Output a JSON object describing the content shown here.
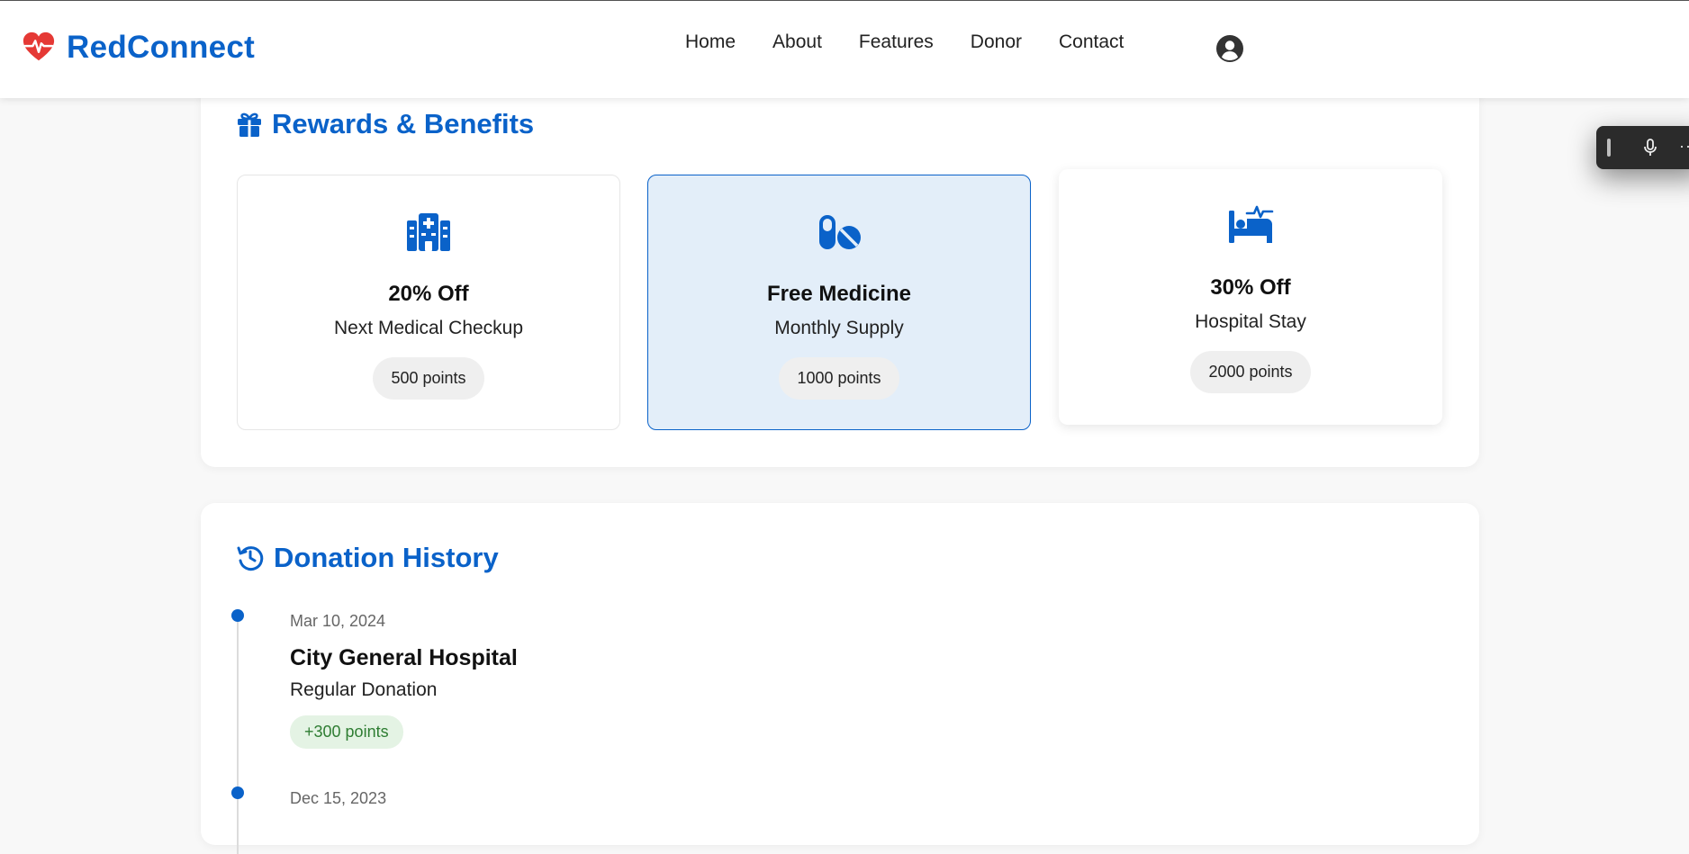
{
  "header": {
    "brand": "RedConnect",
    "nav": [
      "Home",
      "About",
      "Features",
      "Donor",
      "Contact"
    ]
  },
  "rewards": {
    "title": "Rewards & Benefits",
    "items": [
      {
        "title": "20% Off",
        "subtitle": "Next Medical Checkup",
        "points": "500 points",
        "icon": "hospital-icon"
      },
      {
        "title": "Free Medicine",
        "subtitle": "Monthly Supply",
        "points": "1000 points",
        "icon": "pills-icon",
        "selected": true
      },
      {
        "title": "30% Off",
        "subtitle": "Hospital Stay",
        "points": "2000 points",
        "icon": "hospital-bed-icon"
      }
    ]
  },
  "history": {
    "title": "Donation History",
    "entries": [
      {
        "date": "Mar 10, 2024",
        "place": "City General Hospital",
        "type": "Regular Donation",
        "points": "+300 points"
      },
      {
        "date": "Dec 15, 2023"
      }
    ]
  },
  "colors": {
    "brand": "#0a62c9",
    "heart": "#e53935",
    "selected_bg": "#e3eef9",
    "points_green": "#2e7d32",
    "points_green_bg": "#e4f3e4"
  }
}
